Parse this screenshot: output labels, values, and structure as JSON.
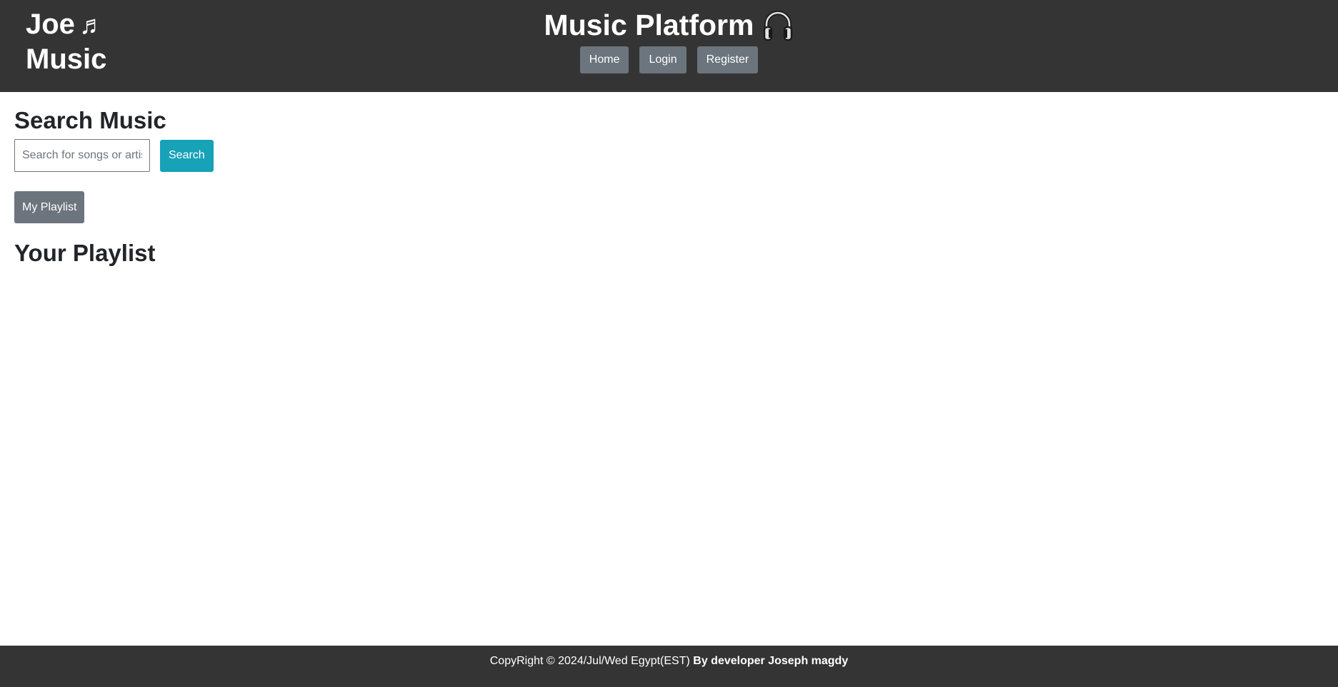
{
  "header": {
    "logo_line1": "Joe",
    "logo_line2": "Music",
    "logo_note": "♬",
    "title": "Music Platform",
    "title_icon": "headphones-icon",
    "nav": [
      {
        "label": "Home"
      },
      {
        "label": "Login"
      },
      {
        "label": "Register"
      }
    ]
  },
  "search": {
    "heading": "Search Music",
    "placeholder": "Search for songs or artists",
    "value": "",
    "button_label": "Search"
  },
  "playlist": {
    "button_label": "My Playlist",
    "heading": "Your Playlist",
    "items": []
  },
  "footer": {
    "copyright": "CopyRight © 2024/Jul/Wed Egypt(EST)",
    "developer": "By developer Joseph magdy"
  },
  "colors": {
    "header_bg": "#343434",
    "nav_button": "#6c757d",
    "search_button": "#17a2b8",
    "footer_bg": "#343434"
  }
}
